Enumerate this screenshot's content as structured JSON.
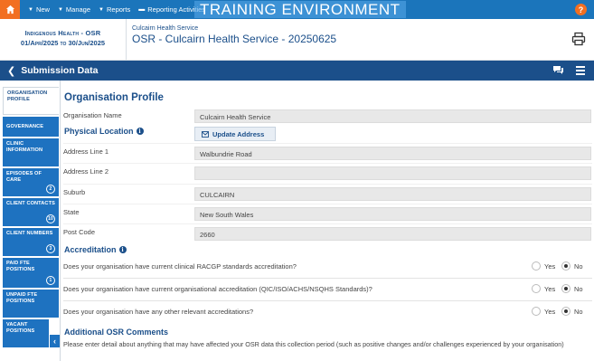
{
  "nav": {
    "new_label": "New",
    "manage_label": "Manage",
    "reports_label": "Reports",
    "reporting_label": "Reporting Activities",
    "environment_banner": "TRAINING ENVIRONMENT",
    "help_label": "?"
  },
  "header": {
    "org_line1": "Indigenous Health - OSR",
    "org_line2": "01/Apr/2025 to 30/Jun/2025",
    "service_label": "Culcairn Health Service",
    "form_title": "OSR - Culcairn Health Service - 20250625"
  },
  "subbar": {
    "title": "Submission Data"
  },
  "tabs": [
    {
      "label": "Organisation Profile",
      "badge": ""
    },
    {
      "label": "Governance",
      "badge": ""
    },
    {
      "label": "Clinic Information",
      "badge": ""
    },
    {
      "label": "Episodes of Care",
      "badge": "2"
    },
    {
      "label": "Client Contacts",
      "badge": "10"
    },
    {
      "label": "Client Numbers",
      "badge": "3"
    },
    {
      "label": "Paid FTE Positions",
      "badge": "1"
    },
    {
      "label": "Unpaid FTE Positions",
      "badge": ""
    },
    {
      "label": "Vacant Positions",
      "badge": ""
    }
  ],
  "profile": {
    "heading": "Organisation Profile",
    "org_name_label": "Organisation Name",
    "org_name_value": "Culcairn Health Service",
    "location_heading": "Physical Location",
    "update_address_label": "Update Address",
    "address1_label": "Address Line 1",
    "address1_value": "Walbundrie Road",
    "address2_label": "Address Line 2",
    "address2_value": "",
    "suburb_label": "Suburb",
    "suburb_value": "CULCAIRN",
    "state_label": "State",
    "state_value": "New South Wales",
    "postcode_label": "Post Code",
    "postcode_value": "2660"
  },
  "accreditation": {
    "heading": "Accreditation",
    "yes_label": "Yes",
    "no_label": "No",
    "questions": [
      {
        "text": "Does your organisation have current clinical RACGP standards accreditation?",
        "selected": "No"
      },
      {
        "text": "Does your organisation have current organisational accreditation (QIC/ISO/ACHS/NSQHS Standards)?",
        "selected": "No"
      },
      {
        "text": "Does your organisation have any other relevant accreditations?",
        "selected": "No"
      }
    ]
  },
  "comments": {
    "heading": "Additional OSR Comments",
    "prompt": "Please enter detail about anything that may have affected your OSR data this collection period (such as positive changes and/or challenges experienced by your organisation)"
  },
  "colors": {
    "topbar": "#1b75bb",
    "home": "#f26f21",
    "subbar": "#1b4f8a",
    "tab": "#1e72c0",
    "heading": "#1b4f8a"
  }
}
